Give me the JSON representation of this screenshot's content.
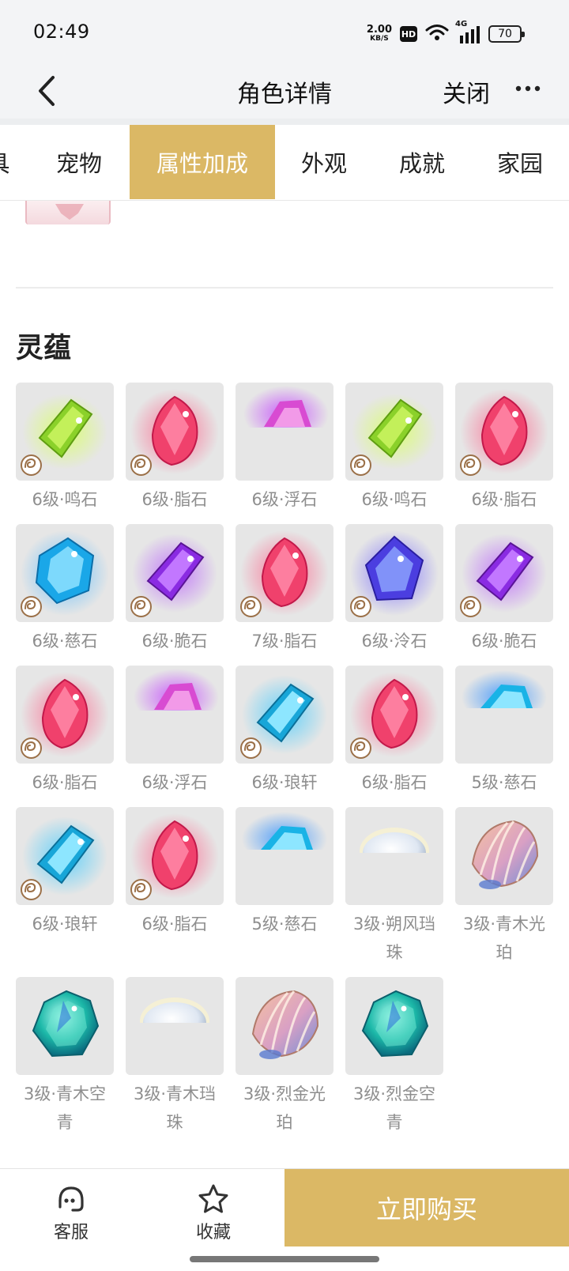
{
  "status_bar": {
    "time": "02:49",
    "net_speed_value": "2.00",
    "net_speed_unit": "KB/S",
    "hd_badge": "HD",
    "network_type": "4G",
    "battery": "70"
  },
  "nav": {
    "title": "角色详情",
    "close_label": "关闭"
  },
  "tabs": [
    {
      "label": "具",
      "active": false
    },
    {
      "label": "宠物",
      "active": false
    },
    {
      "label": "属性加成",
      "active": true
    },
    {
      "label": "外观",
      "active": false
    },
    {
      "label": "成就",
      "active": false
    },
    {
      "label": "家园",
      "active": false
    }
  ],
  "section": {
    "title": "灵蕴"
  },
  "gems": [
    {
      "label": "6级·鸣石",
      "kind": "green-crystal",
      "badge": true
    },
    {
      "label": "6级·脂石",
      "kind": "pink-gem",
      "badge": true
    },
    {
      "label": "6级·浮石",
      "kind": "purple-partial",
      "badge": false
    },
    {
      "label": "6级·鸣石",
      "kind": "green-crystal",
      "badge": true
    },
    {
      "label": "6级·脂石",
      "kind": "pink-gem",
      "badge": true
    },
    {
      "label": "6级·慈石",
      "kind": "blue-gem",
      "badge": true
    },
    {
      "label": "6级·脆石",
      "kind": "purple-crystal",
      "badge": true
    },
    {
      "label": "7级·脂石",
      "kind": "pink-gem",
      "badge": true
    },
    {
      "label": "6级·泠石",
      "kind": "violet-gem",
      "badge": true
    },
    {
      "label": "6级·脆石",
      "kind": "purple-crystal",
      "badge": true
    },
    {
      "label": "6级·脂石",
      "kind": "pink-gem",
      "badge": true
    },
    {
      "label": "6级·浮石",
      "kind": "purple-partial",
      "badge": false
    },
    {
      "label": "6级·琅轩",
      "kind": "cyan-crystal",
      "badge": true
    },
    {
      "label": "6级·脂石",
      "kind": "pink-gem",
      "badge": true
    },
    {
      "label": "5级·慈石",
      "kind": "blue-partial",
      "badge": false
    },
    {
      "label": "6级·琅轩",
      "kind": "cyan-crystal",
      "badge": true
    },
    {
      "label": "6级·脂石",
      "kind": "pink-gem",
      "badge": true
    },
    {
      "label": "5级·慈石",
      "kind": "blue-partial",
      "badge": false
    },
    {
      "label": "3级·朔风珰珠",
      "kind": "pearl",
      "badge": false
    },
    {
      "label": "3级·青木光珀",
      "kind": "shell",
      "badge": false
    },
    {
      "label": "3级·青木空青",
      "kind": "teal-gem",
      "badge": false
    },
    {
      "label": "3级·青木珰珠",
      "kind": "pearl",
      "badge": false
    },
    {
      "label": "3级·烈金光珀",
      "kind": "shell",
      "badge": false
    },
    {
      "label": "3级·烈金空青",
      "kind": "teal-gem",
      "badge": false
    }
  ],
  "bottom_bar": {
    "service_label": "客服",
    "favorite_label": "收藏",
    "buy_label": "立即购买"
  },
  "colors": {
    "accent": "#dbb865",
    "label_gray": "#8e8e8e",
    "tile_bg": "#e6e6e6"
  },
  "icons": {
    "back": "chevron-left-icon",
    "more": "more-dots-icon",
    "service": "headset-chat-icon",
    "favorite": "star-outline-icon",
    "wifi": "wifi-icon",
    "signal": "signal-icon",
    "battery": "battery-icon"
  }
}
